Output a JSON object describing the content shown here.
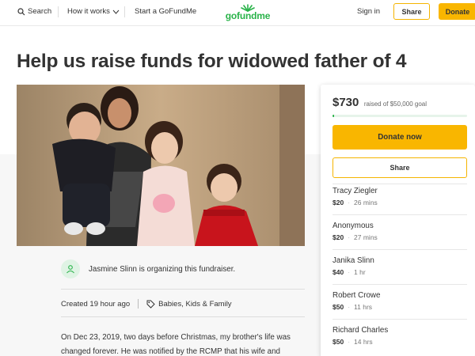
{
  "header": {
    "search_label": "Search",
    "how_it_works_label": "How it works",
    "start_label": "Start a GoFundMe",
    "logo_text": "gofundme",
    "signin_label": "Sign in",
    "share_label": "Share",
    "donate_label": "Donate"
  },
  "title": "Help us raise funds for widowed father of 4",
  "organizer": {
    "text": "Jasmine Slinn is organizing this fundraiser."
  },
  "meta": {
    "created": "Created 19 hour ago",
    "category": "Babies, Kids & Family"
  },
  "story": "On Dec 23, 2019, two days before Christmas, my brother's life was changed forever. He was notified by the RCMP that his wife and",
  "campaign": {
    "raised": "$730",
    "goal_text": "raised of $50,000 goal",
    "progress_fraction": 0.0146,
    "donate_now_label": "Donate now",
    "share_label": "Share"
  },
  "donors": [
    {
      "name": "Tracy Ziegler",
      "amount": "$20",
      "time": "26 mins"
    },
    {
      "name": "Anonymous",
      "amount": "$20",
      "time": "27 mins"
    },
    {
      "name": "Janika Slinn",
      "amount": "$40",
      "time": "1 hr"
    },
    {
      "name": "Robert Crowe",
      "amount": "$50",
      "time": "11 hrs"
    },
    {
      "name": "Richard Charles",
      "amount": "$50",
      "time": "14 hrs"
    }
  ],
  "colors": {
    "brand_green": "#2ab34a",
    "donate_yellow": "#f9b600"
  }
}
